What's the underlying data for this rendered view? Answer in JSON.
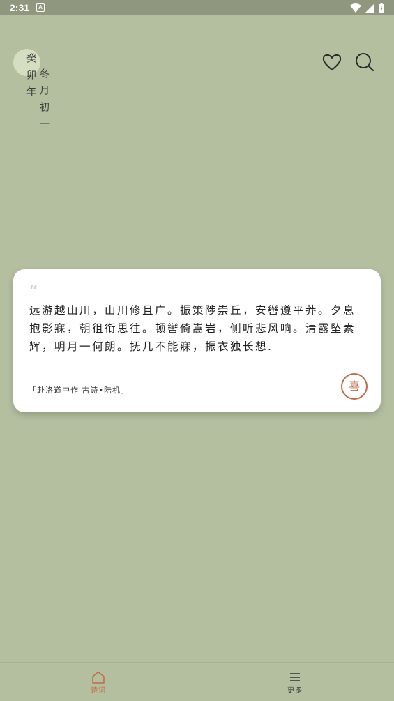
{
  "status_bar": {
    "time": "2:31",
    "notification_icon": "A"
  },
  "date": {
    "col1": "癸卯年",
    "col2": "冬月初一"
  },
  "icons": {
    "favorite": "heart-icon",
    "search": "search-icon"
  },
  "poem": {
    "quote_mark": "“",
    "text": "远游越山川，山川修且广。振策陟崇丘，安辔遵平莽。夕息抱影寐，朝徂衔思往。顿辔倚嵩岩，侧听悲风响。清露坠素辉，明月一何朗。抚几不能寐，振衣独长想.",
    "source": "「赴洛道中作 古诗•陆机」",
    "like_label": "喜"
  },
  "nav": {
    "items": [
      {
        "label": "诗词",
        "icon": "home-icon",
        "active": true
      },
      {
        "label": "更多",
        "icon": "menu-icon",
        "active": false
      }
    ]
  },
  "colors": {
    "background": "#b4bfa0",
    "accent": "#c26a48",
    "card": "#ffffff"
  }
}
